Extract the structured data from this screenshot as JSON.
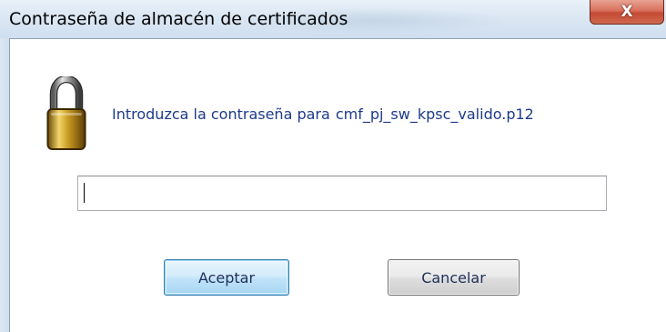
{
  "window": {
    "title": "Contraseña de almacén de certificados",
    "close_glyph": "X"
  },
  "dialog": {
    "prompt_text": "Introduzca la contraseña para",
    "filename": "cmf_pj_sw_kpsc_valido.p12",
    "lock_icon": "padlock-icon",
    "password_value": "",
    "password_placeholder": ""
  },
  "buttons": {
    "accept_label": "Aceptar",
    "cancel_label": "Cancelar"
  },
  "colors": {
    "prompt_text": "#1e3a8a",
    "close_button": "#c44a33",
    "accept_border": "#3c7fb1"
  }
}
